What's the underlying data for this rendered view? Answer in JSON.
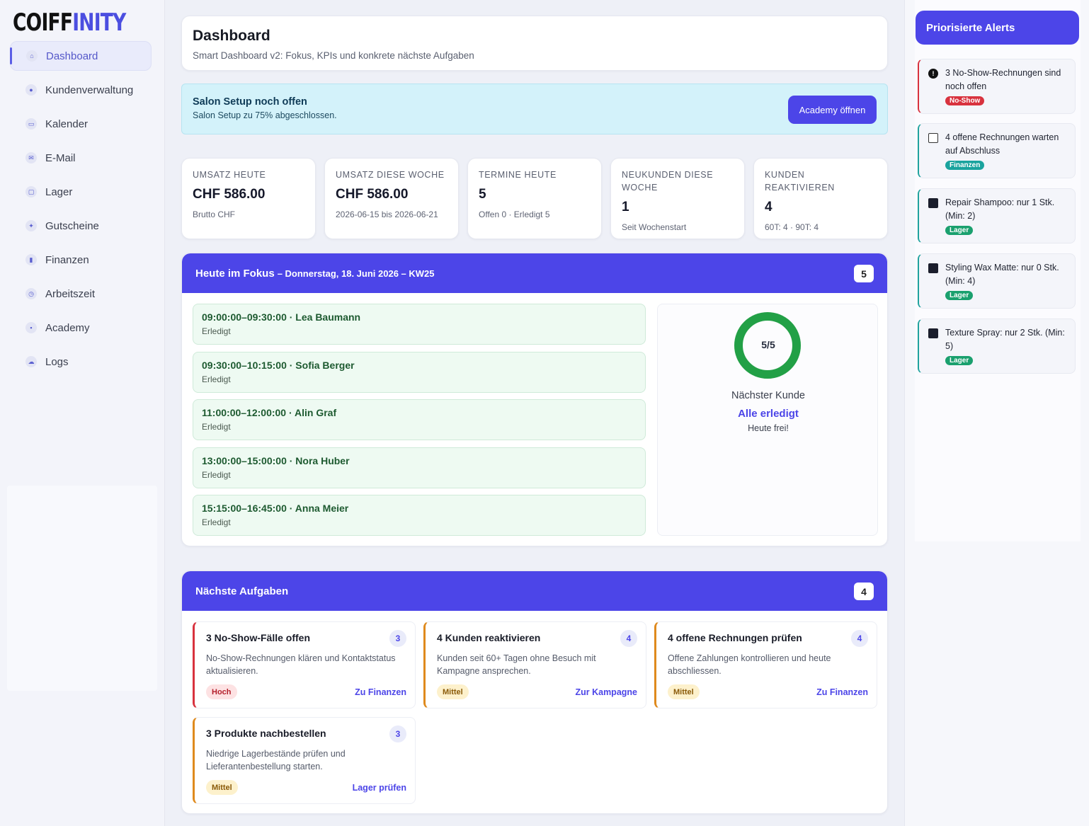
{
  "app": {
    "logo_part1": "COIFF",
    "logo_part2": "INITY",
    "accent_color": "#4c45e8"
  },
  "sidebar": {
    "items": [
      {
        "label": "Dashboard",
        "icon": "home-icon",
        "active": true
      },
      {
        "label": "Kundenverwaltung",
        "icon": "users-icon",
        "active": false
      },
      {
        "label": "Kalender",
        "icon": "calendar-icon",
        "active": false
      },
      {
        "label": "E-Mail",
        "icon": "mail-icon",
        "active": false
      },
      {
        "label": "Lager",
        "icon": "box-icon",
        "active": false
      },
      {
        "label": "Gutscheine",
        "icon": "voucher-icon",
        "active": false
      },
      {
        "label": "Finanzen",
        "icon": "chart-icon",
        "active": false
      },
      {
        "label": "Arbeitszeit",
        "icon": "clock-icon",
        "active": false
      },
      {
        "label": "Academy",
        "icon": "lock-icon",
        "active": false
      },
      {
        "label": "Logs",
        "icon": "cloud-icon",
        "active": false
      }
    ]
  },
  "header": {
    "title": "Dashboard",
    "subtitle": "Smart Dashboard v2: Fokus, KPIs und konkrete nächste Aufgaben"
  },
  "setup_banner": {
    "title": "Salon Setup noch offen",
    "text": "Salon Setup zu 75% abgeschlossen.",
    "button_label": "Academy öffnen"
  },
  "kpis": [
    {
      "label": "UMSATZ HEUTE",
      "value": "CHF 586.00",
      "sub": "Brutto CHF"
    },
    {
      "label": "UMSATZ DIESE WOCHE",
      "value": "CHF 586.00",
      "sub": "2026-06-15 bis 2026-06-21"
    },
    {
      "label": "TERMINE HEUTE",
      "value": "5",
      "sub": "Offen 0 · Erledigt 5"
    },
    {
      "label": "NEUKUNDEN DIESE WOCHE",
      "value": "1",
      "sub": "Seit Wochenstart"
    },
    {
      "label": "KUNDEN REAKTIVIEREN",
      "value": "4",
      "sub": "60T: 4 · 90T: 4"
    }
  ],
  "focus": {
    "title": "Heute im Fokus",
    "date_label": "– Donnerstag, 18. Juni 2026 – KW25",
    "count": "5",
    "appointments": [
      {
        "title": "09:00:00–09:30:00 · Lea Baumann",
        "status": "Erledigt"
      },
      {
        "title": "09:30:00–10:15:00 · Sofia Berger",
        "status": "Erledigt"
      },
      {
        "title": "11:00:00–12:00:00 · Alin Graf",
        "status": "Erledigt"
      },
      {
        "title": "13:00:00–15:00:00 · Nora Huber",
        "status": "Erledigt"
      },
      {
        "title": "15:15:00–16:45:00 · Anna Meier",
        "status": "Erledigt"
      }
    ],
    "progress": {
      "label": "5/5",
      "done": 5,
      "total": 5,
      "color": "#22a046"
    },
    "next_label": "Nächster Kunde",
    "next_value": "Alle erledigt",
    "next_sub": "Heute frei!"
  },
  "tasks": {
    "title": "Nächste Aufgaben",
    "count": "4",
    "items": [
      {
        "title": "3 No-Show-Fälle offen",
        "count": "3",
        "text": "No-Show-Rechnungen klären und Kontaktstatus aktualisieren.",
        "priority": "Hoch",
        "level": "high",
        "link": "Zu Finanzen"
      },
      {
        "title": "4 Kunden reaktivieren",
        "count": "4",
        "text": "Kunden seit 60+ Tagen ohne Besuch mit Kampagne ansprechen.",
        "priority": "Mittel",
        "level": "mid",
        "link": "Zur Kampagne"
      },
      {
        "title": "4 offene Rechnungen prüfen",
        "count": "4",
        "text": "Offene Zahlungen kontrollieren und heute abschliessen.",
        "priority": "Mittel",
        "level": "mid",
        "link": "Zu Finanzen"
      },
      {
        "title": "3 Produkte nachbestellen",
        "count": "3",
        "text": "Niedrige Lagerbestände prüfen und Lieferantenbestellung starten.",
        "priority": "Mittel",
        "level": "mid",
        "link": "Lager prüfen"
      }
    ]
  },
  "alerts": {
    "title": "Priorisierte Alerts",
    "items": [
      {
        "text": "3 No-Show-Rechnungen sind noch offen",
        "badge": "No-Show",
        "icon": "warning-icon"
      },
      {
        "text": "4 offene Rechnungen warten auf Abschluss",
        "badge": "Finanzen",
        "icon": "invoice-icon"
      },
      {
        "text": "Repair Shampoo: nur 1 Stk. (Min: 2)",
        "badge": "Lager",
        "icon": "package-icon"
      },
      {
        "text": "Styling Wax Matte: nur 0 Stk. (Min: 4)",
        "badge": "Lager",
        "icon": "package-icon"
      },
      {
        "text": "Texture Spray: nur 2 Stk. (Min: 5)",
        "badge": "Lager",
        "icon": "package-icon"
      }
    ]
  }
}
